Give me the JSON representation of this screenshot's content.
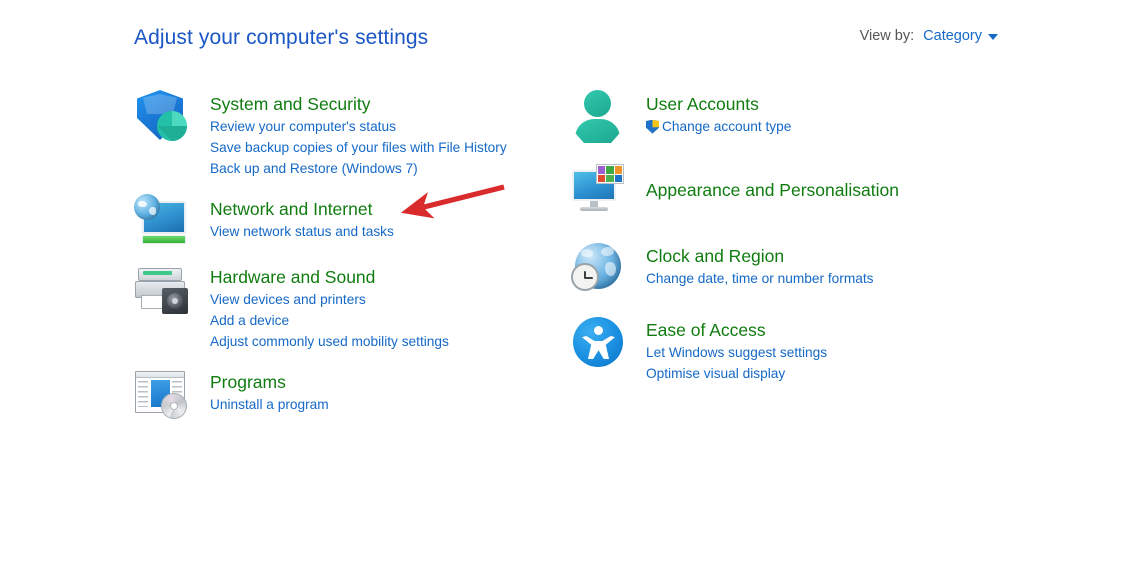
{
  "header": {
    "title": "Adjust your computer's settings",
    "view_by_label": "View by:",
    "view_by_value": "Category",
    "caret_icon": "chevron-down-icon"
  },
  "colors": {
    "title_blue": "#1a56c4",
    "category_green": "#107c10",
    "link_blue": "#1569c7",
    "label_gray": "#555555",
    "annotation_red": "#d92b2b",
    "background": "#ffffff"
  },
  "left_column": [
    {
      "id": "system-and-security",
      "title": "System and Security",
      "icon": "shield-icon",
      "links": [
        {
          "text": "Review your computer's status",
          "shield": false
        },
        {
          "text": "Save backup copies of your files with File History",
          "shield": false
        },
        {
          "text": "Back up and Restore (Windows 7)",
          "shield": false
        }
      ]
    },
    {
      "id": "network-and-internet",
      "title": "Network and Internet",
      "icon": "network-monitor-globe-icon",
      "links": [
        {
          "text": "View network status and tasks",
          "shield": false
        }
      ]
    },
    {
      "id": "hardware-and-sound",
      "title": "Hardware and Sound",
      "icon": "printer-speaker-icon",
      "links": [
        {
          "text": "View devices and printers",
          "shield": false
        },
        {
          "text": "Add a device",
          "shield": false
        },
        {
          "text": "Adjust commonly used mobility settings",
          "shield": false
        }
      ]
    },
    {
      "id": "programs",
      "title": "Programs",
      "icon": "program-window-disc-icon",
      "links": [
        {
          "text": "Uninstall a program",
          "shield": false
        }
      ]
    }
  ],
  "right_column": [
    {
      "id": "user-accounts",
      "title": "User Accounts",
      "icon": "person-icon",
      "links": [
        {
          "text": "Change account type",
          "shield": true
        }
      ]
    },
    {
      "id": "appearance-and-personalisation",
      "title": "Appearance and Personalisation",
      "icon": "monitor-swatches-icon",
      "links": []
    },
    {
      "id": "clock-and-region",
      "title": "Clock and Region",
      "icon": "globe-clock-icon",
      "links": [
        {
          "text": "Change date, time or number formats",
          "shield": false
        }
      ]
    },
    {
      "id": "ease-of-access",
      "title": "Ease of Access",
      "icon": "accessibility-icon",
      "links": [
        {
          "text": "Let Windows suggest settings",
          "shield": false
        },
        {
          "text": "Optimise visual display",
          "shield": false
        }
      ]
    }
  ],
  "annotation": {
    "type": "arrow",
    "color": "#d92b2b",
    "points_to": "network-and-internet"
  },
  "appearance_swatches": [
    "#9c5fd0",
    "#3fa845",
    "#f0932b",
    "#e04a2f",
    "#4caf50",
    "#1e72c8"
  ]
}
